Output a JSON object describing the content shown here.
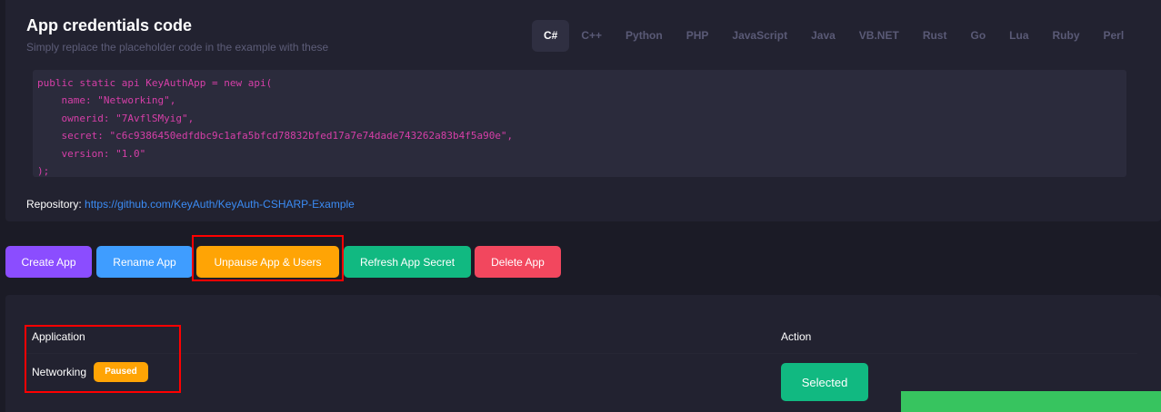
{
  "credentials": {
    "title": "App credentials code",
    "subtitle": "Simply replace the placeholder code in the example with these",
    "languages": [
      "C#",
      "C++",
      "Python",
      "PHP",
      "JavaScript",
      "Java",
      "VB.NET",
      "Rust",
      "Go",
      "Lua",
      "Ruby",
      "Perl"
    ],
    "active_language": "C#",
    "code_lines": [
      "public static api KeyAuthApp = new api(",
      "    name: \"Networking\",",
      "    ownerid: \"7AvflSMyig\",",
      "    secret: \"c6c9386450edfdbc9c1afa5bfcd78832bfed17a7e74dade743262a83b4f5a90e\",",
      "    version: \"1.0\"",
      ");"
    ],
    "repo_label": "Repository:",
    "repo_link": "https://github.com/KeyAuth/KeyAuth-CSHARP-Example"
  },
  "actions": {
    "create": "Create App",
    "rename": "Rename App",
    "unpause": "Unpause App & Users",
    "refresh": "Refresh App Secret",
    "delete": "Delete App"
  },
  "table": {
    "col_application": "Application",
    "col_action": "Action",
    "rows": [
      {
        "name": "Networking",
        "status": "Paused",
        "action": "Selected"
      }
    ]
  },
  "colors": {
    "background": "#1b1b26",
    "card": "#222230",
    "code_text": "#d63fa8",
    "link": "#3b8cf5",
    "create": "#8b4dff",
    "rename": "#3f9dff",
    "unpause": "#ffa405",
    "refresh": "#11b981",
    "delete": "#f2475e",
    "toast": "#37c45f",
    "highlight": "#ff0000"
  }
}
